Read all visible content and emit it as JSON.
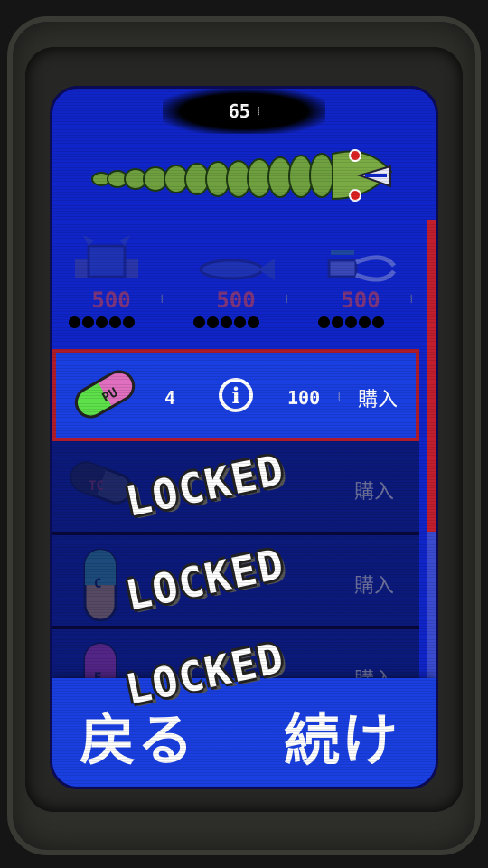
{
  "header": {
    "coins": "65",
    "coin_icon": "coin-stack-icon"
  },
  "upgrades": [
    {
      "icon": "crab-armor-icon",
      "price": "500",
      "coin_icon": "coin-stack-icon",
      "level": 0,
      "max_level": 5
    },
    {
      "icon": "fish-fins-icon",
      "price": "500",
      "coin_icon": "coin-stack-icon",
      "level": 0,
      "max_level": 5
    },
    {
      "icon": "drone-jaws-icon",
      "price": "500",
      "coin_icon": "coin-stack-icon",
      "level": 0,
      "max_level": 5
    }
  ],
  "items": [
    {
      "pill_label": "PU",
      "quantity": "4",
      "info_label": "i",
      "price": "100",
      "buy_label": "購入",
      "locked": false,
      "colors": [
        "#e06fc0",
        "#5de04a"
      ]
    },
    {
      "pill_label": "TC",
      "buy_label": "購入",
      "locked": true,
      "lock_label": "LOCKED",
      "colors": [
        "#222222",
        "#444444"
      ]
    },
    {
      "pill_label": "C",
      "buy_label": "購入",
      "locked": true,
      "lock_label": "LOCKED",
      "colors": [
        "#3aa37d",
        "#e0a23a"
      ]
    },
    {
      "pill_label": "E",
      "buy_label": "購入",
      "locked": true,
      "lock_label": "LOCKED",
      "colors": [
        "#d63aa0",
        "#5a1a5a"
      ]
    }
  ],
  "footer": {
    "back_label": "戻る",
    "continue_label": "続け"
  },
  "colors": {
    "screen": "#1025c8",
    "selected_border": "#b01b2a",
    "scroll_thumb": "#c21f2e"
  }
}
